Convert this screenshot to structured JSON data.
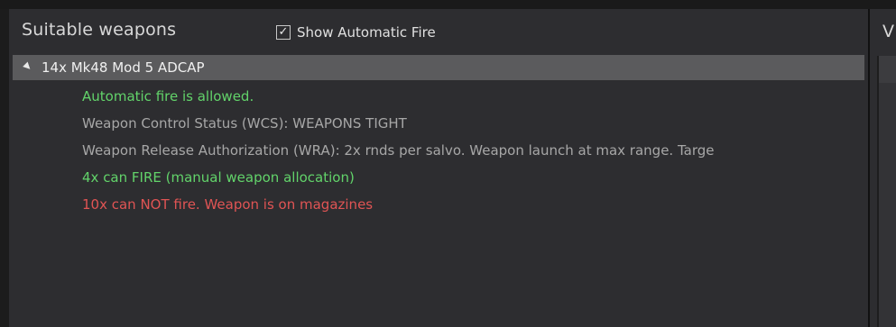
{
  "panel": {
    "title": "Suitable weapons",
    "show_auto_fire": {
      "checked_glyph": "✓",
      "label": "Show Automatic Fire"
    }
  },
  "tree": {
    "expander_icon": "▲",
    "item_label": "14x Mk48 Mod 5 ADCAP",
    "details": [
      {
        "text": "Automatic fire is allowed.",
        "color": "#62d36a"
      },
      {
        "text": "Weapon Control Status (WCS): WEAPONS TIGHT",
        "color": "#a7a7a7"
      },
      {
        "text": "Weapon Release Authorization (WRA): 2x rnds per salvo. Weapon launch at max range.  Targe",
        "color": "#a7a7a7"
      },
      {
        "text": "4x can FIRE (manual weapon allocation)",
        "color": "#62d36a"
      },
      {
        "text": "10x can NOT fire. Weapon is on magazines",
        "color": "#e05454"
      }
    ]
  },
  "right_panel": {
    "title_partial": "V"
  }
}
